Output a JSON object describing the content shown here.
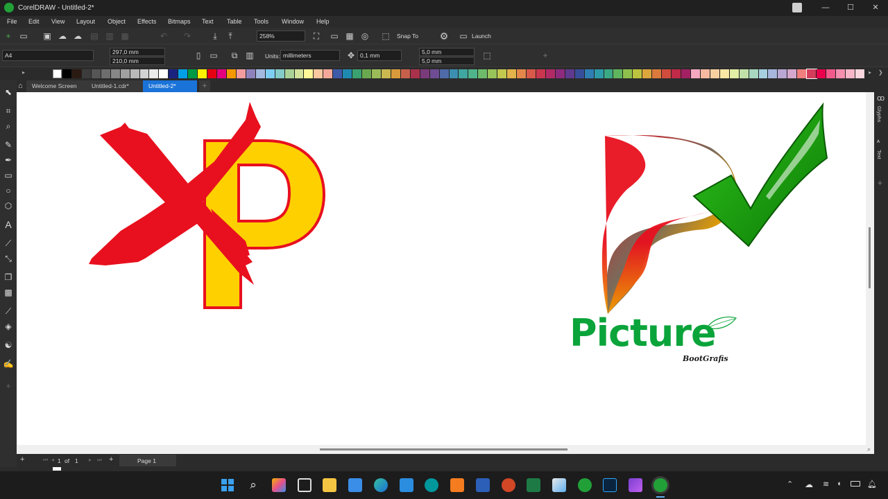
{
  "window": {
    "title": "CorelDRAW - Untitled-2*",
    "controls": [
      "—",
      "☐",
      "✕"
    ]
  },
  "menu": [
    "File",
    "Edit",
    "View",
    "Layout",
    "Object",
    "Effects",
    "Bitmaps",
    "Text",
    "Table",
    "Tools",
    "Window",
    "Help"
  ],
  "toolbar": {
    "zoom": "258%",
    "snap_to": "Snap To",
    "launch": "Launch"
  },
  "property_bar": {
    "page_size": "A4",
    "width": "297,0 mm",
    "height": "210,0 mm",
    "units_label": "Units:",
    "units_value": "millimeters",
    "nudge": "0,1 mm",
    "dup_x": "5,0 mm",
    "dup_y": "5,0 mm"
  },
  "palette": {
    "colors": [
      "#000000",
      "#2b1a12",
      "#3c3c3c",
      "#555555",
      "#6e6e6e",
      "#878787",
      "#a0a0a0",
      "#b9b9b9",
      "#d2d2d2",
      "#ebebeb",
      "#ffffff",
      "#1a237e",
      "#00a0e9",
      "#009944",
      "#fff100",
      "#e60012",
      "#e4007f",
      "#f39800",
      "#f29c9f",
      "#8f82bc",
      "#a3b9e0",
      "#7ecef4",
      "#84ccc9",
      "#aad296",
      "#d3e39c",
      "#fff799",
      "#fac79e",
      "#f5a89a",
      "#3f5aa8",
      "#1f8ab0",
      "#3aa170",
      "#6aa84f",
      "#9bbb59",
      "#c9b94f",
      "#d99a3b",
      "#c7604a",
      "#a8324c",
      "#7a3b7a",
      "#6e4d94",
      "#4e6aa8",
      "#3c8fb0",
      "#40a6a0",
      "#4fb48a",
      "#6dbb6a",
      "#98c45a",
      "#c3c84f",
      "#e3b24a",
      "#e3884a",
      "#d8584a",
      "#c9364e",
      "#b12a66",
      "#8e2a7e",
      "#5f3a8e",
      "#374e9a",
      "#2f7fb4",
      "#2e9ba8",
      "#3aa884",
      "#5fb55e",
      "#8ec04c",
      "#bcc33f",
      "#dca63c",
      "#db7a3c",
      "#d04c3c",
      "#c12a48",
      "#a32063",
      "#f4a9c0",
      "#f6b9a0",
      "#f8d0a0",
      "#fbe7a3",
      "#e3efa5",
      "#c1e1a9",
      "#a8d8c0",
      "#a6cfe0",
      "#a7b6dc",
      "#b9a7d4",
      "#d5a7cd",
      "#f07e7e",
      "#d33c5a",
      "#e8004c",
      "#f15a8a",
      "#f58fb0",
      "#f8b7c9",
      "#fbd6de"
    ],
    "selected_index": 77
  },
  "tabs": [
    {
      "label": "Welcome Screen",
      "active": false
    },
    {
      "label": "Untitled-1.cdr*",
      "active": false
    },
    {
      "label": "Untitled-2*",
      "active": true
    }
  ],
  "side_panel": {
    "tab1": "Glyphs",
    "tab2": "Text"
  },
  "page_nav": {
    "current": "1",
    "of_label": "of",
    "total": "1",
    "page_tab": "Page 1"
  },
  "artwork": {
    "brand_word": "Picture",
    "brand_sub": "BootGrafis",
    "wrong_color": "#e8101e",
    "p_fill": "#ffd000",
    "check_color": "#149b0a",
    "brand_green": "#0aa43a"
  }
}
